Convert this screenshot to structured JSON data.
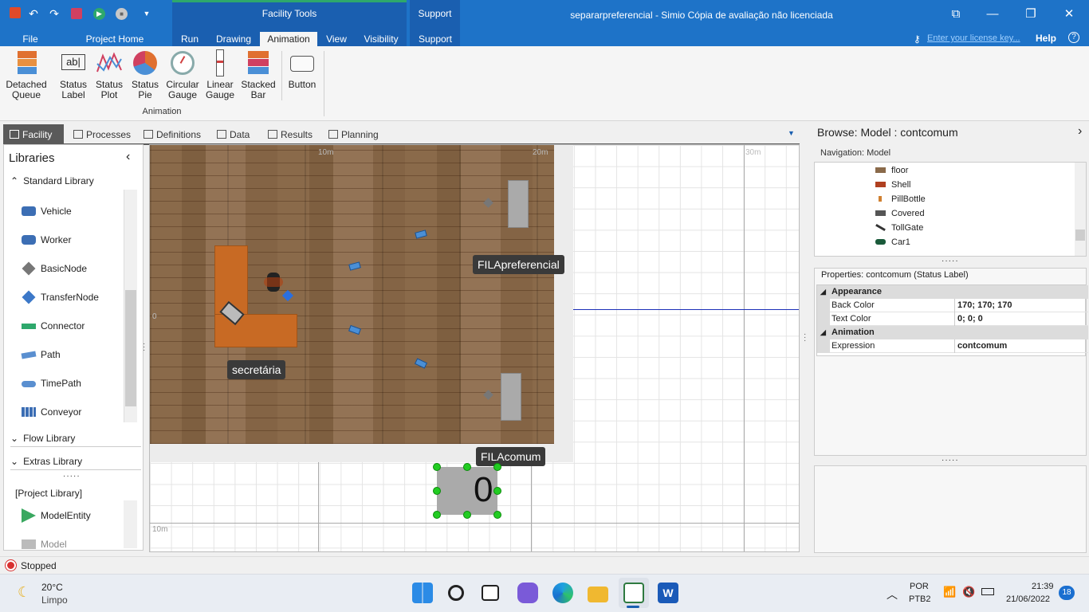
{
  "window": {
    "title": "separarpreferencial - Simio Cópia de avaliação não licenciada",
    "context_group_1": "Facility Tools",
    "context_group_2": "Support",
    "license_link": "Enter your license key...",
    "help": "Help"
  },
  "ribbon_tabs": [
    "File",
    "Project Home",
    "Run",
    "Drawing",
    "Animation",
    "View",
    "Visibility",
    "Support"
  ],
  "ribbon": {
    "group_label": "Animation",
    "buttons": [
      {
        "label1": "Detached",
        "label2": "Queue"
      },
      {
        "label1": "Status",
        "label2": "Label"
      },
      {
        "label1": "Status",
        "label2": "Plot"
      },
      {
        "label1": "Status",
        "label2": "Pie"
      },
      {
        "label1": "Circular",
        "label2": "Gauge"
      },
      {
        "label1": "Linear",
        "label2": "Gauge"
      },
      {
        "label1": "Stacked",
        "label2": "Bar"
      },
      {
        "label1": "Button",
        "label2": ""
      }
    ]
  },
  "view_tabs": [
    "Facility",
    "Processes",
    "Definitions",
    "Data",
    "Results",
    "Planning"
  ],
  "libraries": {
    "title": "Libraries",
    "standard": "Standard Library",
    "items": [
      "Vehicle",
      "Worker",
      "BasicNode",
      "TransferNode",
      "Connector",
      "Path",
      "TimePath",
      "Conveyor"
    ],
    "flow": "Flow Library",
    "extras": "Extras Library",
    "project": "[Project Library]",
    "project_items": [
      "ModelEntity",
      "Model"
    ]
  },
  "canvas": {
    "ruler_10m": "10m",
    "ruler_20m": "20m",
    "ruler_30m": "30m",
    "ruler_0": "0",
    "ruler_bottom_10m": "10m",
    "label_secretaria": "secretária",
    "label_filapref": "FILApreferencial",
    "label_filacomum": "FILAcomum",
    "status_value": "0"
  },
  "browse": {
    "title": "Browse: Model : contcomum",
    "nav_header": "Navigation: Model",
    "nav_items": [
      "floor",
      "Shell",
      "PillBottle",
      "Covered",
      "TollGate",
      "Car1"
    ],
    "props_header": "Properties: contcomum (Status Label)",
    "cat_appearance": "Appearance",
    "cat_animation": "Animation",
    "props": [
      {
        "name": "Back Color",
        "value": "170; 170; 170"
      },
      {
        "name": "Text Color",
        "value": "0; 0; 0"
      },
      {
        "name": "Expression",
        "value": "contcomum"
      }
    ]
  },
  "status": {
    "text": "Stopped"
  },
  "taskbar": {
    "temp": "20°C",
    "weather": "Limpo",
    "lang1": "POR",
    "lang2": "PTB2",
    "time": "21:39",
    "date": "21/06/2022",
    "badge": "18"
  },
  "colors": {
    "titlebar": "#1e73c8",
    "accent": "#1a5fb0",
    "selection": "#22cc22"
  }
}
